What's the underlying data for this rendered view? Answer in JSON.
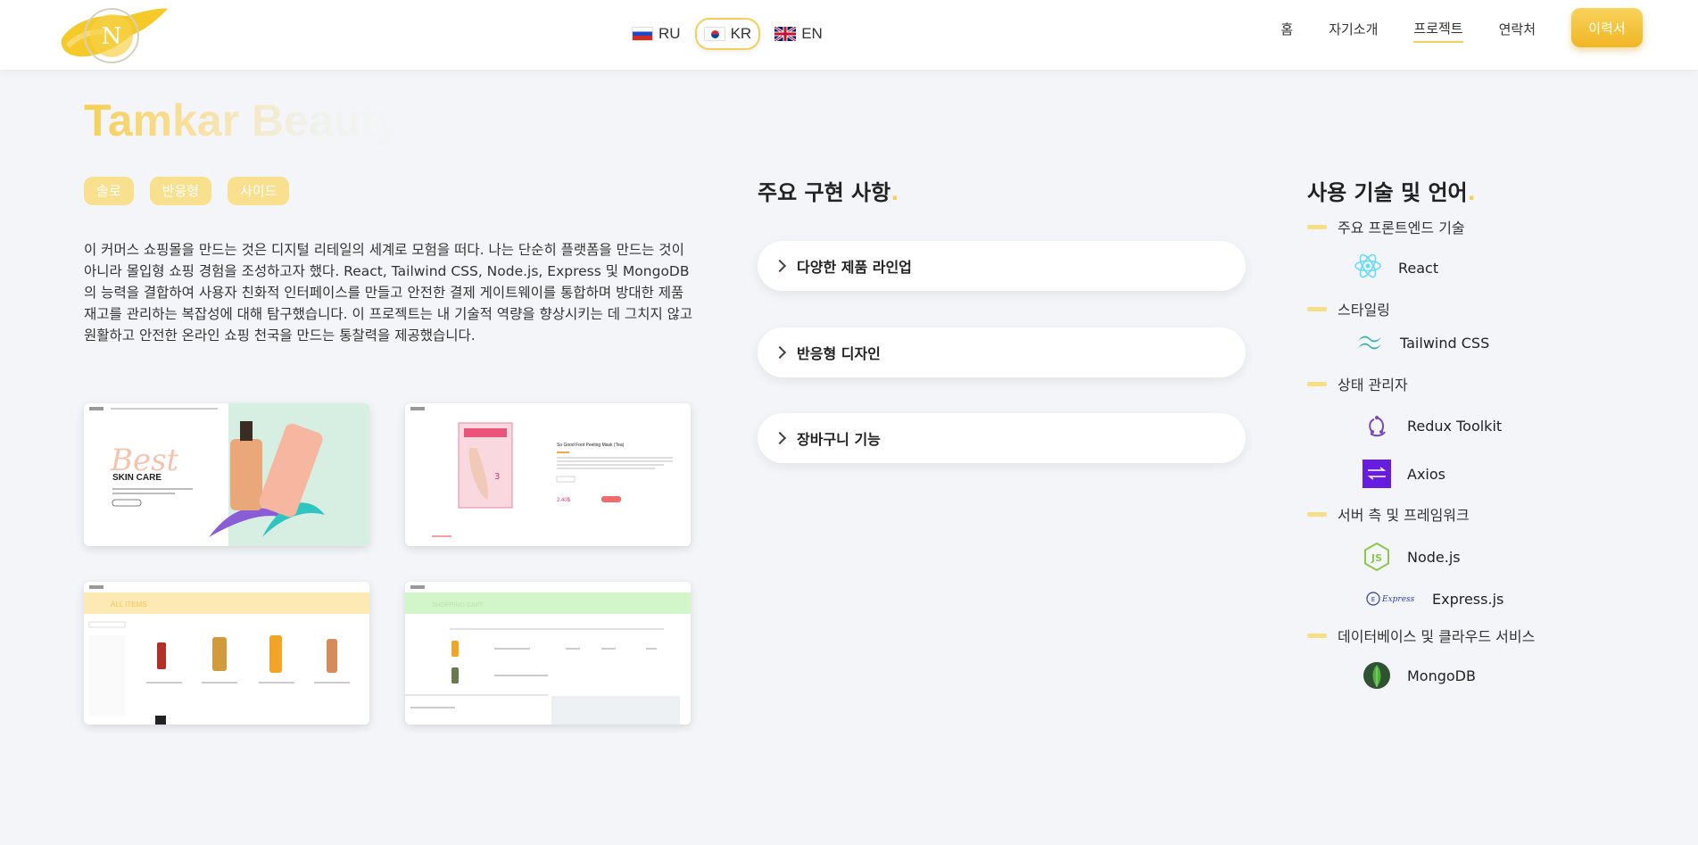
{
  "header": {
    "logo_letter": "N",
    "languages": [
      {
        "code": "RU",
        "active": false
      },
      {
        "code": "KR",
        "active": true
      },
      {
        "code": "EN",
        "active": false
      }
    ],
    "nav": [
      "홈",
      "자기소개",
      "프로젝트",
      "연락처"
    ],
    "nav_current": "프로젝트",
    "resume_label": "이력서"
  },
  "project": {
    "title": "Tamkar Beauty",
    "tags": [
      "솔로",
      "반응형",
      "사이드"
    ],
    "description": "이 커머스 쇼핑몰을 만드는 것은 디지털 리테일의 세계로 모험을 떠다. 나는 단순히 플랫폼을 만드는 것이 아니라 몰입형 쇼핑 경험을 조성하고자 했다. React, Tailwind CSS, Node.js, Express 및 MongoDB의 능력을 결합하여 사용자 친화적 인터페이스를 만들고 안전한 결제 게이트웨이를 통합하며 방대한 제품 재고를 관리하는 복잡성에 대해 탐구했습니다. 이 프로젝트는 내 기술적 역량을 향상시키는 데 그치지 않고 원활하고 안전한 온라인 쇼핑 천국을 만드는 통찰력을 제공했습니다.",
    "screenshots": {
      "hero_big": "Best",
      "hero_sub": "SKIN CARE",
      "product_name": "So Good Foot Peeling Mask (Tea)",
      "product_price": "2.40$",
      "all_items": "ALL ITEMS",
      "cart_heading": "SHOPPING CART"
    }
  },
  "features": {
    "title": "주요 구현 사항",
    "items": [
      "다양한 제품 라인업",
      "반응형 디자인",
      "장바구니 기능"
    ]
  },
  "tech": {
    "title": "사용 기술 및 언어",
    "categories": [
      {
        "label": "주요 프론트엔드 기술",
        "items": [
          {
            "name": "React",
            "icon": "react-icon",
            "color": "#61dafb"
          }
        ]
      },
      {
        "label": "스타일링",
        "items": [
          {
            "name": "Tailwind CSS",
            "icon": "tailwind-icon",
            "color": "#38b2ac"
          }
        ]
      },
      {
        "label": "상태 관리자",
        "items": [
          {
            "name": "Redux Toolkit",
            "icon": "redux-icon",
            "color": "#764abc"
          },
          {
            "name": "Axios",
            "icon": "axios-icon",
            "color": "#5a29e4"
          }
        ]
      },
      {
        "label": "서버 측 및 프레임워크",
        "items": [
          {
            "name": "Node.js",
            "icon": "nodejs-icon",
            "color": "#8cc84b"
          },
          {
            "name": "Express.js",
            "icon": "express-icon",
            "color": "#303f9f"
          }
        ]
      },
      {
        "label": "데이터베이스 및 클라우드 서비스",
        "items": [
          {
            "name": "MongoDB",
            "icon": "mongodb-icon",
            "color": "#4db33d"
          }
        ]
      }
    ]
  }
}
